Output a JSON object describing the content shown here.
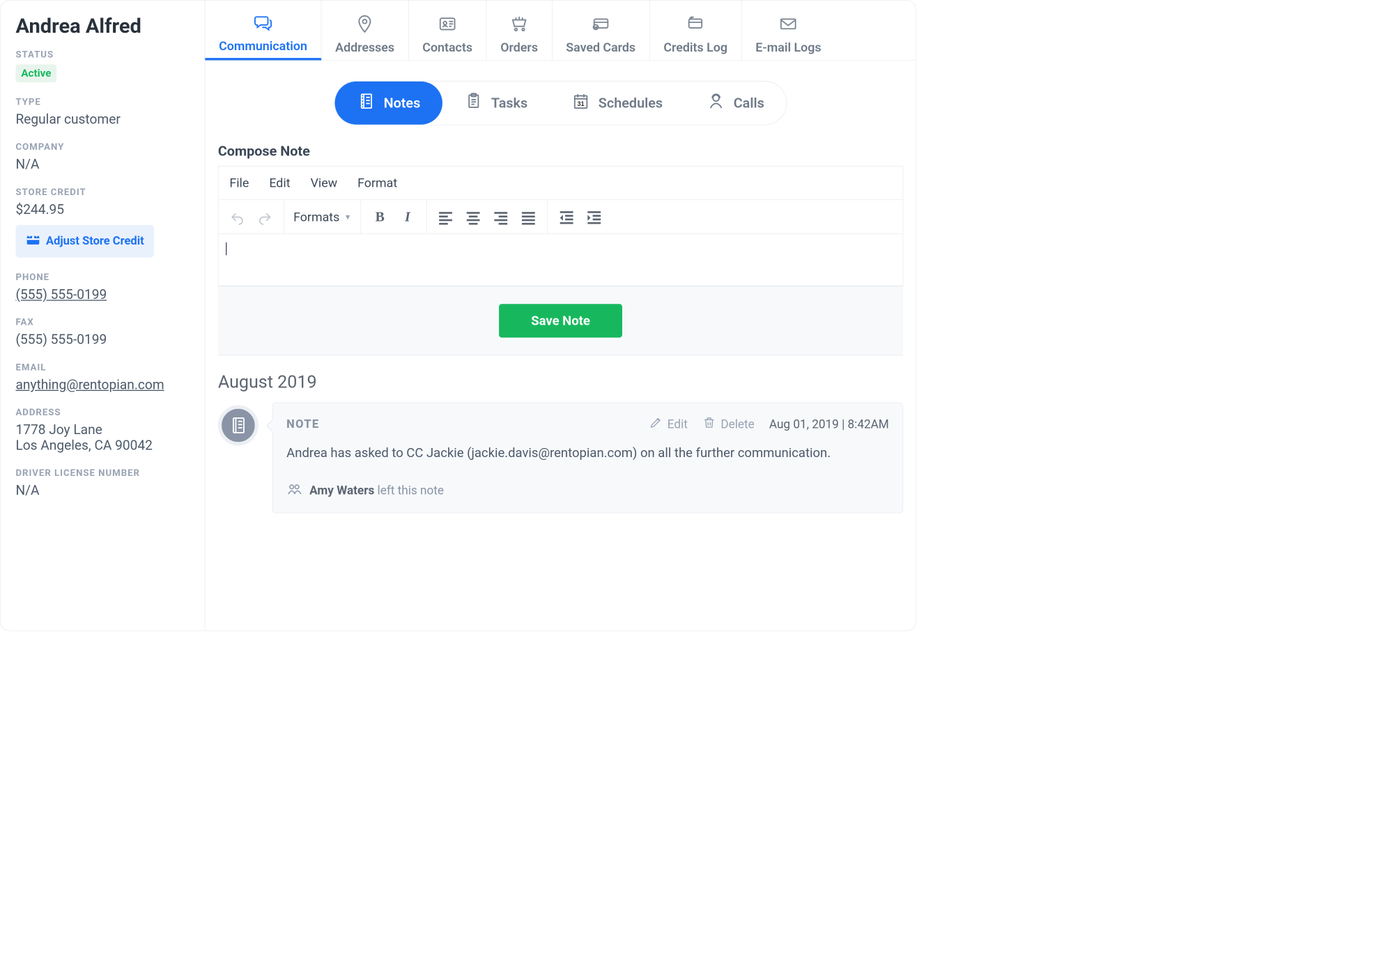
{
  "sidebar": {
    "name": "Andrea Alfred",
    "status_label": "STATUS",
    "status_value": "Active",
    "type_label": "TYPE",
    "type_value": "Regular customer",
    "company_label": "COMPANY",
    "company_value": "N/A",
    "store_credit_label": "STORE CREDIT",
    "store_credit_value": "$244.95",
    "adjust_credit_label": "Adjust Store Credit",
    "phone_label": "PHONE",
    "phone_value": "(555) 555-0199",
    "fax_label": "FAX",
    "fax_value": "(555) 555-0199",
    "email_label": "EMAIL",
    "email_value": "anything@rentopian.com",
    "address_label": "ADDRESS",
    "address_line1": "1778 Joy Lane",
    "address_line2": "Los Angeles, CA 90042",
    "dl_label": "DRIVER LICENSE NUMBER",
    "dl_value": "N/A"
  },
  "tabs": [
    {
      "label": "Communication"
    },
    {
      "label": "Addresses"
    },
    {
      "label": "Contacts"
    },
    {
      "label": "Orders"
    },
    {
      "label": "Saved Cards"
    },
    {
      "label": "Credits Log"
    },
    {
      "label": "E-mail Logs"
    }
  ],
  "pills": {
    "notes": "Notes",
    "tasks": "Tasks",
    "schedules": "Schedules",
    "calls": "Calls"
  },
  "compose": {
    "title": "Compose Note",
    "menu": {
      "file": "File",
      "edit": "Edit",
      "view": "View",
      "format": "Format"
    },
    "formats": "Formats",
    "save": "Save Note"
  },
  "feed": {
    "month": "August 2019",
    "note": {
      "type": "NOTE",
      "edit": "Edit",
      "delete": "Delete",
      "timestamp": "Aug 01, 2019 | 8:42AM",
      "body": "Andrea has asked to CC Jackie (jackie.davis@rentopian.com) on all the further communication.",
      "author": "Amy Waters",
      "left_note": " left this note"
    }
  }
}
